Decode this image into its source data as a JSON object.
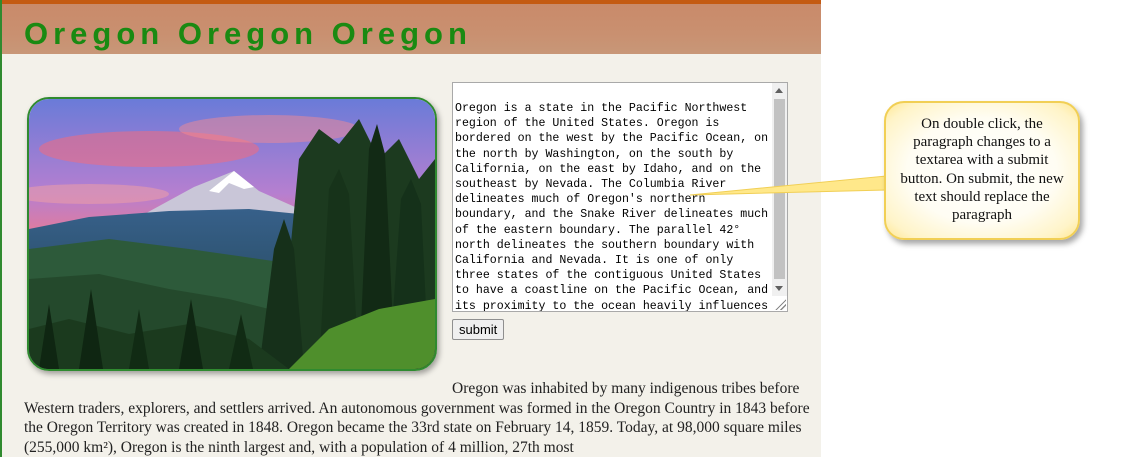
{
  "header": {
    "title": "Oregon Oregon Oregon"
  },
  "photo": {
    "icon": "mount-hood-landscape-image"
  },
  "editor": {
    "text": "Oregon is a state in the Pacific Northwest region of the United States. Oregon is bordered on the west by the Pacific Ocean, on the north by Washington, on the south by California, on the east by Idaho, and on the southeast by Nevada. The Columbia River delineates much of Oregon's northern boundary, and the Snake River delineates much of the eastern boundary. The parallel 42° north delineates the southern boundary with California and Nevada. It is one of only three states of the contiguous United States to have a coastline on the Pacific Ocean, and its proximity to the ocean heavily influences"
  },
  "submit": {
    "label": "submit"
  },
  "paragraph": {
    "text": "Oregon was inhabited by many indigenous tribes before Western traders, explorers, and settlers arrived. An autonomous government was formed in the Oregon Country in 1843 before the Oregon Territory was created in 1848. Oregon became the 33rd state on February 14, 1859. Today, at 98,000 square miles (255,000 km²), Oregon is the ninth largest and, with a population of 4 million, 27th most"
  },
  "callout": {
    "text": "On double click, the paragraph changes to a textarea with a submit button. On submit, the new text should replace the paragraph"
  },
  "colors": {
    "title_green": "#1a8a12",
    "header_band": "#c99070",
    "callout_border": "#f1cf55",
    "page_background": "#f3f1ea"
  }
}
